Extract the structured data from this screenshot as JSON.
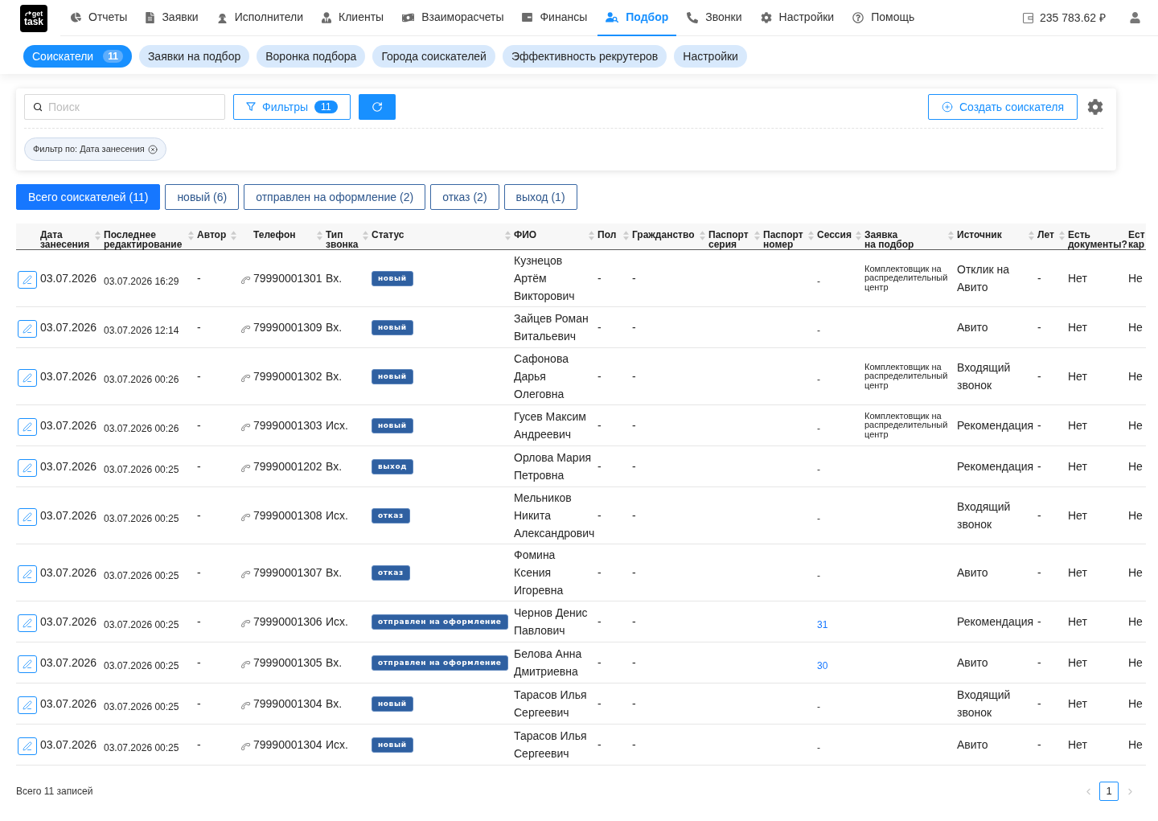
{
  "logo": {
    "lines": [
      "get",
      "task"
    ]
  },
  "nav": [
    {
      "kind": "reports",
      "label": "Отчеты",
      "selected": false
    },
    {
      "kind": "requests",
      "label": "Заявки",
      "selected": false
    },
    {
      "kind": "executors",
      "label": "Исполнители",
      "selected": false
    },
    {
      "kind": "clients",
      "label": "Клиенты",
      "selected": false
    },
    {
      "kind": "settlements",
      "label": "Взаиморасчеты",
      "selected": false
    },
    {
      "kind": "finance",
      "label": "Финансы",
      "selected": false
    },
    {
      "kind": "recruiting",
      "label": "Подбор",
      "selected": true
    },
    {
      "kind": "calls",
      "label": "Звонки",
      "selected": false
    },
    {
      "kind": "settings",
      "label": "Настройки",
      "selected": false
    },
    {
      "kind": "help",
      "label": "Помощь",
      "selected": false
    }
  ],
  "balance": "235 783.62 ₽",
  "subtabs": [
    {
      "label": "Соискатели",
      "count": "11",
      "selected": true
    },
    {
      "label": "Заявки на подбор",
      "selected": false
    },
    {
      "label": "Воронка подбора",
      "selected": false
    },
    {
      "label": "Города соискателей",
      "selected": false
    },
    {
      "label": "Эффективность рекрутеров",
      "selected": false
    },
    {
      "label": "Настройки",
      "selected": false
    }
  ],
  "toolbar": {
    "search": {
      "placeholder": "Поиск"
    },
    "filters_button": {
      "label": "Фильтры",
      "count": "11"
    },
    "create_button": {
      "label": "Создать соискателя"
    }
  },
  "active_filters": [
    {
      "label": "Фильтр по: Дата занесения"
    }
  ],
  "status_filters": [
    {
      "label": "Всего соискателей (11)",
      "selected": true
    },
    {
      "label": "новый (6)",
      "selected": false
    },
    {
      "label": "отправлен на оформление (2)",
      "selected": false
    },
    {
      "label": "отказ (2)",
      "selected": false
    },
    {
      "label": "выход (1)",
      "selected": false
    }
  ],
  "table": {
    "columns": [
      {
        "title": "Дата\nзанесения",
        "sortable": true
      },
      {
        "title": "Последнее\nредактирование",
        "sortable": true
      },
      {
        "title": "Автор",
        "sortable": true
      },
      {
        "title": "Телефон",
        "sortable": true
      },
      {
        "title": "Тип\nзвонка",
        "sortable": true
      },
      {
        "title": "Статус",
        "sortable": true
      },
      {
        "title": "ФИО",
        "sortable": true
      },
      {
        "title": "Пол",
        "sortable": true
      },
      {
        "title": "Гражданство",
        "sortable": true
      },
      {
        "title": "Паспорт\nсерия",
        "sortable": true
      },
      {
        "title": "Паспорт\nномер",
        "sortable": true
      },
      {
        "title": "Сессия",
        "sortable": true
      },
      {
        "title": "Заявка\nна подбор",
        "sortable": true
      },
      {
        "title": "Источник",
        "sortable": true
      },
      {
        "title": "Лет",
        "sortable": true
      },
      {
        "title": "Есть\nдокументы?",
        "sortable": false
      },
      {
        "title": "Ест\nкар",
        "sortable": false
      }
    ],
    "rows": [
      {
        "date": "03.07.2026",
        "edited": "03.07.2026 16:29",
        "author": "-",
        "phone": "79990001301",
        "call_type": "Вх.",
        "status": "новый",
        "fio": "Кузнецов\nАртём\nВикторович",
        "gender": "-",
        "citizenship": "-",
        "session": {
          "text": "-",
          "link": false
        },
        "request": "Комплектовщик на\nраспределительный\nцентр",
        "source": "Отклик на\nАвито",
        "age": "-",
        "documents": "Нет",
        "column_17": "Не"
      },
      {
        "date": "03.07.2026",
        "edited": "03.07.2026 12:14",
        "author": "-",
        "phone": "79990001309",
        "call_type": "Вх.",
        "status": "новый",
        "fio": "Зайцев Роман\nВитальевич",
        "gender": "-",
        "citizenship": "-",
        "session": {
          "text": "-",
          "link": false
        },
        "source": "Авито",
        "age": "-",
        "documents": "Нет",
        "column_17": "Не"
      },
      {
        "date": "03.07.2026",
        "edited": "03.07.2026 00:26",
        "author": "-",
        "phone": "79990001302",
        "call_type": "Вх.",
        "status": "новый",
        "fio": "Сафонова\nДарья\nОлеговна",
        "gender": "-",
        "citizenship": "-",
        "session": {
          "text": "-",
          "link": false
        },
        "request": "Комплектовщик на\nраспределительный\nцентр",
        "source": "Входящий\nзвонок",
        "age": "-",
        "documents": "Нет",
        "column_17": "Не"
      },
      {
        "date": "03.07.2026",
        "edited": "03.07.2026 00:26",
        "author": "-",
        "phone": "79990001303",
        "call_type": "Исх.",
        "status": "новый",
        "fio": "Гусев Максим\nАндреевич",
        "gender": "-",
        "citizenship": "-",
        "session": {
          "text": "-",
          "link": false
        },
        "request": "Комплектовщик на\nраспределительный\nцентр",
        "source": "Рекомендация",
        "age": "-",
        "documents": "Нет",
        "column_17": "Не"
      },
      {
        "date": "03.07.2026",
        "edited": "03.07.2026 00:25",
        "author": "-",
        "phone": "79990001202",
        "call_type": "Вх.",
        "status": "выход",
        "fio": "Орлова Мария\nПетровна",
        "gender": "-",
        "citizenship": "-",
        "session": {
          "text": "-",
          "link": false
        },
        "source": "Рекомендация",
        "age": "-",
        "documents": "Нет",
        "column_17": "Не"
      },
      {
        "date": "03.07.2026",
        "edited": "03.07.2026 00:25",
        "author": "-",
        "phone": "79990001308",
        "call_type": "Исх.",
        "status": "отказ",
        "fio": "Мельников\nНикита\nАлександрович",
        "gender": "-",
        "citizenship": "-",
        "session": {
          "text": "-",
          "link": false
        },
        "source": "Входящий\nзвонок",
        "age": "-",
        "documents": "Нет",
        "column_17": "Не"
      },
      {
        "date": "03.07.2026",
        "edited": "03.07.2026 00:25",
        "author": "-",
        "phone": "79990001307",
        "call_type": "Вх.",
        "status": "отказ",
        "fio": "Фомина\nКсения\nИгоревна",
        "gender": "-",
        "citizenship": "-",
        "session": {
          "text": "-",
          "link": false
        },
        "source": "Авито",
        "age": "-",
        "documents": "Нет",
        "column_17": "Не"
      },
      {
        "date": "03.07.2026",
        "edited": "03.07.2026 00:25",
        "author": "-",
        "phone": "79990001306",
        "call_type": "Исх.",
        "status": "отправлен на оформление",
        "fio": "Чернов Денис\nПавлович",
        "gender": "-",
        "citizenship": "-",
        "session": {
          "text": "31",
          "link": true
        },
        "source": "Рекомендация",
        "age": "-",
        "documents": "Нет",
        "column_17": "Не"
      },
      {
        "date": "03.07.2026",
        "edited": "03.07.2026 00:25",
        "author": "-",
        "phone": "79990001305",
        "call_type": "Вх.",
        "status": "отправлен на оформление",
        "fio": "Белова Анна\nДмитриевна",
        "gender": "-",
        "citizenship": "-",
        "session": {
          "text": "30",
          "link": true
        },
        "source": "Авито",
        "age": "-",
        "documents": "Нет",
        "column_17": "Не"
      },
      {
        "date": "03.07.2026",
        "edited": "03.07.2026 00:25",
        "author": "-",
        "phone": "79990001304",
        "call_type": "Вх.",
        "status": "новый",
        "fio": "Тарасов Илья\nСергеевич",
        "gender": "-",
        "citizenship": "-",
        "session": {
          "text": "-",
          "link": false
        },
        "source": "Входящий\nзвонок",
        "age": "-",
        "documents": "Нет",
        "column_17": "Не"
      },
      {
        "date": "03.07.2026",
        "edited": "03.07.2026 00:25",
        "author": "-",
        "phone": "79990001304",
        "call_type": "Исх.",
        "status": "новый",
        "fio": "Тарасов Илья\nСергеевич",
        "gender": "-",
        "citizenship": "-",
        "session": {
          "text": "-",
          "link": false
        },
        "source": "Авито",
        "age": "-",
        "documents": "Нет",
        "column_17": "Не"
      }
    ]
  },
  "footer": {
    "total": "Всего 11 записей"
  },
  "pagination": {
    "previous": {
      "disabled": true
    },
    "pages": [
      {
        "label": "1",
        "selected": true
      }
    ],
    "next": {
      "disabled": true
    }
  }
}
